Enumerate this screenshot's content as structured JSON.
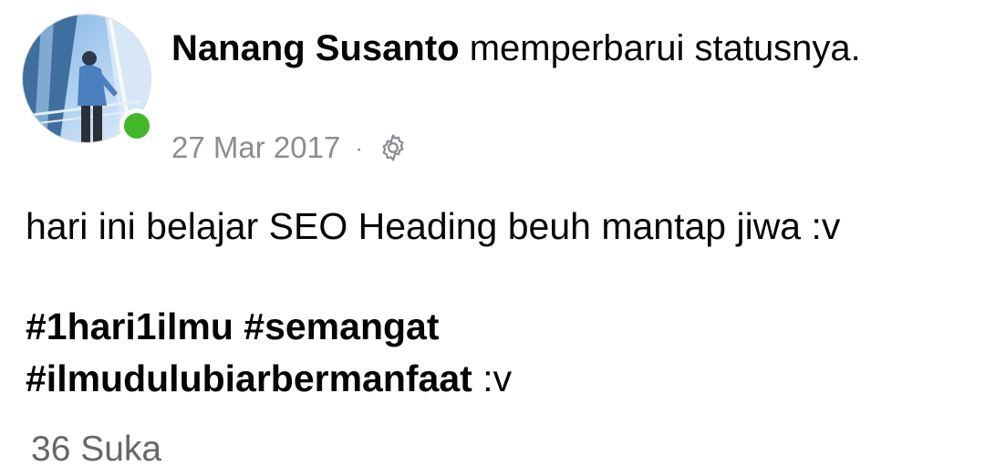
{
  "post": {
    "author": {
      "name": "Nanang Susanto",
      "action": " memperbarui statusnya.",
      "online": true
    },
    "meta": {
      "timestamp": "27 Mar 2017",
      "separator": "·",
      "privacy_icon": "gear-icon"
    },
    "body": {
      "text": "hari ini belajar SEO Heading beuh mantap jiwa :v",
      "hashtags_line1": "#1hari1ilmu #semangat",
      "hashtags_line2": "#ilmudulubiarbermanfaat",
      "suffix": " :v"
    },
    "reactions": {
      "likes": "36 Suka"
    }
  },
  "colors": {
    "online": "#42b72a",
    "meta_text": "#8a8d91",
    "likes_text": "#65676b"
  }
}
